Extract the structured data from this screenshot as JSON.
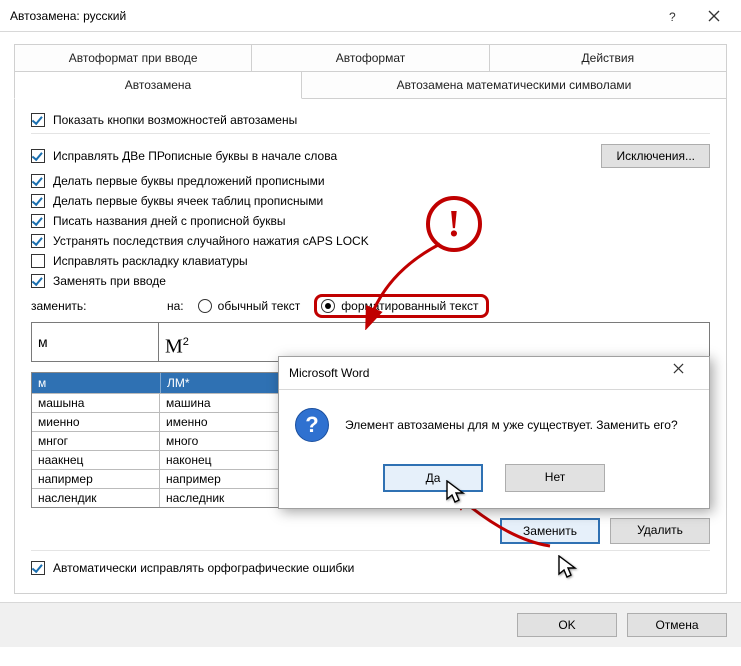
{
  "title": "Автозамена: русский",
  "tabs_top": [
    "Автоформат при вводе",
    "Автоформат",
    "Действия"
  ],
  "tabs_bottom": [
    "Автозамена",
    "Автозамена математическими символами"
  ],
  "chk_show_buttons": "Показать кнопки возможностей автозамены",
  "chk_two_caps": "Исправлять ДВе ПРописные буквы в начале слова",
  "chk_sentence_caps": "Делать первые буквы предложений прописными",
  "chk_cell_caps": "Делать первые буквы ячеек таблиц прописными",
  "chk_day_caps": "Писать названия дней с прописной буквы",
  "chk_capslock": "Устранять последствия случайного нажатия cAPS LOCK",
  "chk_keyboard": "Исправлять раскладку клавиатуры",
  "chk_replace": "Заменять при вводе",
  "exceptions_btn": "Исключения...",
  "replace_label": "заменить:",
  "with_label": "на:",
  "radio_plain": "обычный текст",
  "radio_formatted": "форматированный текст",
  "input_replace": "м",
  "input_with_html": "М<sup>2</sup>",
  "table_header": {
    "c1": "м",
    "c2": "ЛМ*"
  },
  "table_rows": [
    {
      "c1": "машына",
      "c2": "машина"
    },
    {
      "c1": "миенно",
      "c2": "именно"
    },
    {
      "c1": "мнгог",
      "c2": "много"
    },
    {
      "c1": "наакнец",
      "c2": "наконец"
    },
    {
      "c1": "напирмер",
      "c2": "например"
    },
    {
      "c1": "наслендик",
      "c2": "наследник"
    }
  ],
  "btn_replace": "Заменить",
  "btn_delete": "Удалить",
  "chk_spell": "Автоматически исправлять орфографические ошибки",
  "btn_ok": "OK",
  "btn_cancel": "Отмена",
  "msgbox": {
    "title": "Microsoft Word",
    "text": "Элемент автозамены для м уже существует. Заменить его?",
    "yes": "Да",
    "no": "Нет"
  },
  "annotation_mark": "!"
}
